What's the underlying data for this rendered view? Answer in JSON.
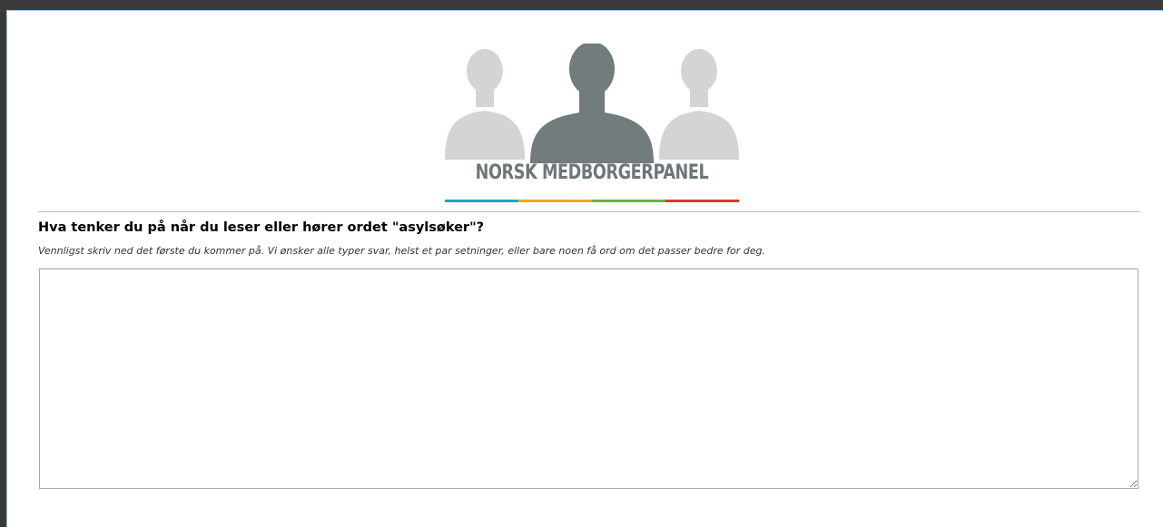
{
  "logo": {
    "text": "NORSK MEDBORGERPANEL",
    "stripe_colors": [
      "#1aa7c9",
      "#f0a81e",
      "#6cb23f",
      "#e23a2c"
    ],
    "figure_colors": {
      "side": "#d3d5d4",
      "center": "#737c7c"
    }
  },
  "question": {
    "title": "Hva tenker du på når du leser eller hører ordet \"asylsøker\"?",
    "help": "Vennligst skriv ned det første du kommer på. Vi ønsker alle typer svar, helst et par setninger, eller bare noen få ord om det passer bedre for deg.",
    "answer_value": ""
  }
}
